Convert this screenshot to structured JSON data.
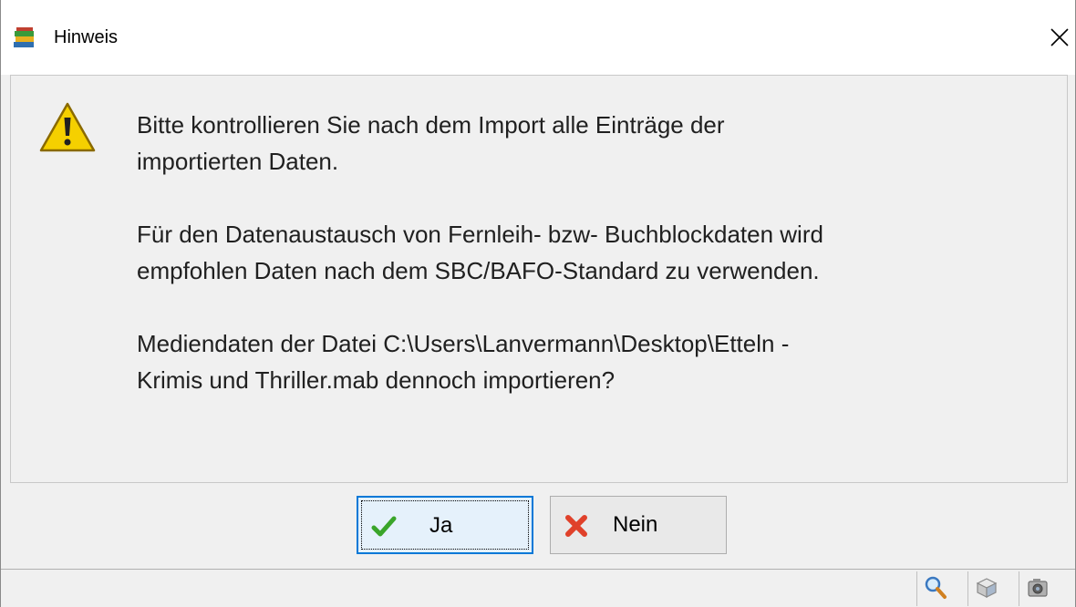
{
  "window": {
    "title": "Hinweis",
    "close_icon": "close-icon"
  },
  "message": {
    "icon": "warning-icon",
    "paragraph1_line1": "Bitte kontrollieren Sie nach dem Import alle Einträge der",
    "paragraph1_line2": "importierten Daten.",
    "paragraph2_line1": "Für den Datenaustausch von Fernleih- bzw- Buchblockdaten wird",
    "paragraph2_line2": "empfohlen Daten nach dem SBC/BAFO-Standard zu verwenden.",
    "paragraph3_line1": "Mediendaten der Datei C:\\Users\\Lanvermann\\Desktop\\Etteln -",
    "paragraph3_line2": "Krimis und Thriller.mab dennoch importieren?"
  },
  "buttons": {
    "yes_label": "Ja",
    "yes_icon": "checkmark-icon",
    "no_label": "Nein",
    "no_icon": "x-mark-icon"
  },
  "statusbar": {
    "icons": [
      "magnifier-icon",
      "box-icon",
      "camera-icon"
    ]
  },
  "colors": {
    "focus_border": "#0078d7",
    "check_green": "#3aa52a",
    "x_red": "#e0412a",
    "warning_yellow": "#f5d000"
  }
}
